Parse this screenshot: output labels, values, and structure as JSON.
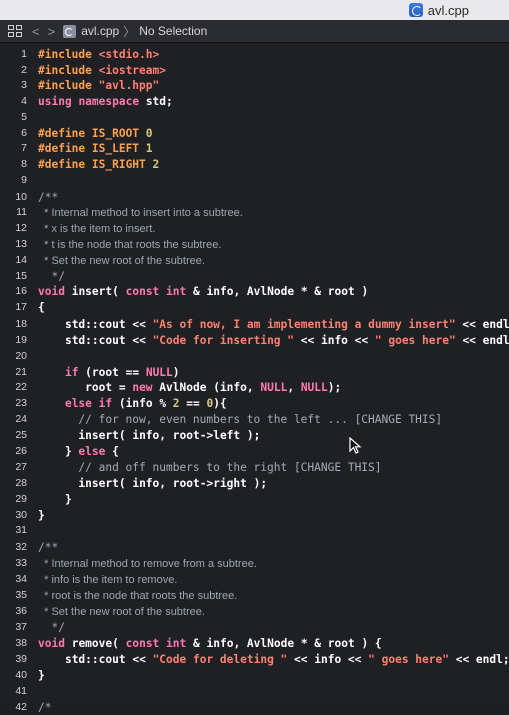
{
  "window": {
    "file_tab": "avl.cpp"
  },
  "navbar": {
    "filename": "avl.cpp",
    "selection": "No Selection",
    "separator": "〉"
  },
  "lines": [
    {
      "n": "1",
      "t": "#include <stdio.h>",
      "c": "pp"
    },
    {
      "n": "2",
      "t": "#include <iostream>",
      "c": "pp"
    },
    {
      "n": "3",
      "t": "#include \"avl.hpp\"",
      "c": "pp"
    },
    {
      "n": "4",
      "t": "using namespace std;",
      "c": "kwline"
    },
    {
      "n": "5",
      "t": "",
      "c": "plain"
    },
    {
      "n": "6",
      "t": "#define IS_ROOT 0",
      "c": "pp"
    },
    {
      "n": "7",
      "t": "#define IS_LEFT 1",
      "c": "pp"
    },
    {
      "n": "8",
      "t": "#define IS_RIGHT 2",
      "c": "pp"
    },
    {
      "n": "9",
      "t": "",
      "c": "plain"
    },
    {
      "n": "10",
      "t": "/**",
      "c": "cmt"
    },
    {
      "n": "11",
      "t": "  * Internal method to insert into a subtree.",
      "c": "doc"
    },
    {
      "n": "12",
      "t": "  * x is the item to insert.",
      "c": "doc"
    },
    {
      "n": "13",
      "t": "  * t is the node that roots the subtree.",
      "c": "doc"
    },
    {
      "n": "14",
      "t": "  * Set the new root of the subtree.",
      "c": "doc"
    },
    {
      "n": "15",
      "t": "  */",
      "c": "cmt"
    },
    {
      "n": "16",
      "t": "void insert( const int & info, AvlNode * & root )",
      "c": "sig"
    },
    {
      "n": "17",
      "t": "{",
      "c": "plain"
    },
    {
      "n": "18",
      "t": "    std::cout << \"As of now, I am implementing a dummy insert\" << endl;",
      "c": "cout"
    },
    {
      "n": "19",
      "t": "    std::cout << \"Code for inserting \" << info << \" goes here\" << endl;",
      "c": "cout"
    },
    {
      "n": "20",
      "t": "",
      "c": "plain"
    },
    {
      "n": "21",
      "t": "    if (root == NULL)",
      "c": "if"
    },
    {
      "n": "22",
      "t": "       root = new AvlNode (info, NULL, NULL);",
      "c": "new"
    },
    {
      "n": "23",
      "t": "    else if (info % 2 == 0){",
      "c": "elseif"
    },
    {
      "n": "24",
      "t": "      // for now, even numbers to the left ... [CHANGE THIS]",
      "c": "cmtline"
    },
    {
      "n": "25",
      "t": "      insert( info, root->left );",
      "c": "plain"
    },
    {
      "n": "26",
      "t": "    } else {",
      "c": "else"
    },
    {
      "n": "27",
      "t": "      // and off numbers to the right [CHANGE THIS]",
      "c": "cmtline"
    },
    {
      "n": "28",
      "t": "      insert( info, root->right );",
      "c": "plain"
    },
    {
      "n": "29",
      "t": "    }",
      "c": "plain"
    },
    {
      "n": "30",
      "t": "}",
      "c": "plain"
    },
    {
      "n": "31",
      "t": "",
      "c": "plain"
    },
    {
      "n": "32",
      "t": "/**",
      "c": "cmt"
    },
    {
      "n": "33",
      "t": "  * Internal method to remove from a subtree.",
      "c": "doc"
    },
    {
      "n": "34",
      "t": "  * info is the item to remove.",
      "c": "doc"
    },
    {
      "n": "35",
      "t": "  * root is the node that roots the subtree.",
      "c": "doc"
    },
    {
      "n": "36",
      "t": "  * Set the new root of the subtree.",
      "c": "doc"
    },
    {
      "n": "37",
      "t": "  */",
      "c": "cmt"
    },
    {
      "n": "38",
      "t": "void remove( const int & info, AvlNode * & root ) {",
      "c": "sig2"
    },
    {
      "n": "39",
      "t": "    std::cout << \"Code for deleting \" << info << \" goes here\" << endl;",
      "c": "cout"
    },
    {
      "n": "40",
      "t": "}",
      "c": "plain"
    },
    {
      "n": "41",
      "t": "",
      "c": "plain"
    },
    {
      "n": "42",
      "t": "/*",
      "c": "cmt"
    }
  ],
  "icons": {
    "cursor": "mouse-pointer-icon"
  }
}
